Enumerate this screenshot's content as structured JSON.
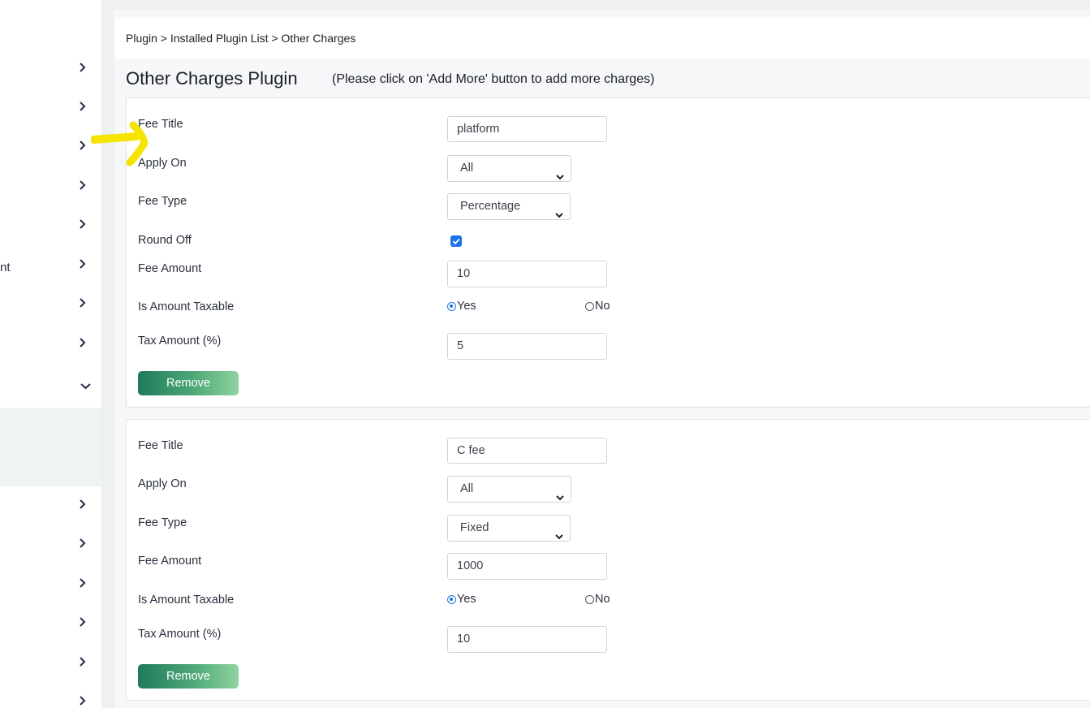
{
  "breadcrumb": {
    "text": "Plugin > Installed Plugin List > Other Charges"
  },
  "page": {
    "title": "Other Charges Plugin",
    "hint": "(Please click on 'Add More' button to add more charges)"
  },
  "sidebar": {
    "partial_label": "nt",
    "expanded_icon": "chevron-down-icon",
    "collapsed_icon": "chevron-right-icon"
  },
  "labels": {
    "fee_title": "Fee Title",
    "apply_on": "Apply On",
    "fee_type": "Fee Type",
    "round_off": "Round Off",
    "fee_amount": "Fee Amount",
    "is_amount_taxable": "Is Amount Taxable",
    "tax_amount": "Tax Amount (%)",
    "yes": "Yes",
    "no": "No",
    "remove": "Remove"
  },
  "charges": [
    {
      "fee_title": "platform",
      "apply_on": "All",
      "fee_type": "Percentage",
      "round_off": true,
      "fee_amount": "10",
      "is_amount_taxable": "Yes",
      "tax_amount": "5"
    },
    {
      "fee_title": "C fee",
      "apply_on": "All",
      "fee_type": "Fixed",
      "fee_amount": "1000",
      "is_amount_taxable": "Yes",
      "tax_amount": "10"
    }
  ],
  "colors": {
    "accent": "#1a73e8",
    "annotation": "#f5e400",
    "button_start": "#1f7a5c",
    "button_end": "#8fd3a0"
  }
}
